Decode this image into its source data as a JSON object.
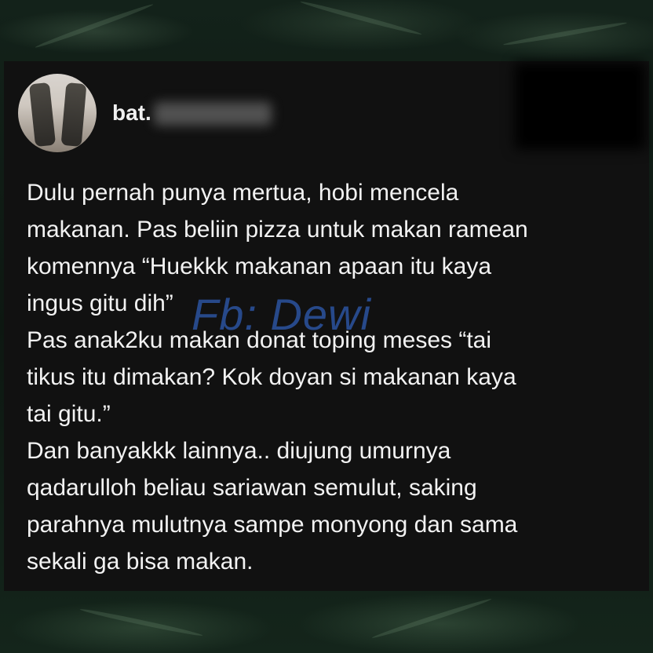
{
  "post": {
    "username": "bat.",
    "text": "Dulu pernah punya mertua, hobi mencela\nmakanan. Pas beliin pizza untuk makan ramean\nkomennya “Huekkk makanan apaan itu kaya\ningus gitu dih”\nPas anak2ku makan donat toping meses “tai\ntikus itu dimakan? Kok doyan si makanan kaya\ntai gitu.”\nDan banyakkk lainnya.. diujung umurnya\nqadarulloh beliau sariawan semulut, saking\nparahnya mulutnya sampe monyong dan sama\nsekali ga bisa makan."
  },
  "watermark": "Fb: Dewi",
  "colors": {
    "card_background": "#111111",
    "text": "#f2f2f2",
    "watermark": "#2c54a0"
  }
}
